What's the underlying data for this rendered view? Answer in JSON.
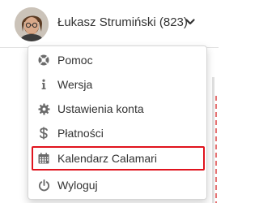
{
  "header": {
    "user_name": "Łukasz Strumiński (823)",
    "avatar_icon": "user-avatar",
    "dropdown_icon": "chevron-down-icon"
  },
  "menu": {
    "items": [
      {
        "label": "Pomoc",
        "icon": "lifebuoy-icon"
      },
      {
        "label": "Wersja",
        "icon": "info-icon"
      },
      {
        "label": "Ustawienia konta",
        "icon": "gear-icon"
      },
      {
        "label": "Płatności",
        "icon": "dollar-icon"
      },
      {
        "label": "Kalendarz Calamari",
        "icon": "calendar-icon",
        "highlighted": true
      },
      {
        "label": "Wyloguj",
        "icon": "power-icon"
      }
    ]
  },
  "colors": {
    "icon": "#6b6b6b",
    "highlight_border": "#e0141e",
    "text": "#333333"
  }
}
